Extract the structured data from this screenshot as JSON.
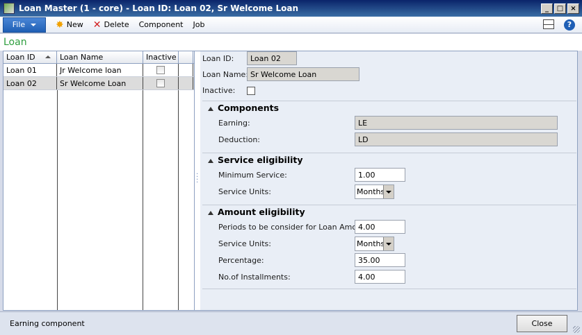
{
  "window": {
    "title": "Loan Master (1 - core) - Loan ID: Loan 02, Sr Welcome Loan"
  },
  "toolbar": {
    "file_label": "File",
    "new_label": "New",
    "delete_label": "Delete",
    "component_label": "Component",
    "job_label": "Job"
  },
  "form": {
    "title": "Loan"
  },
  "grid": {
    "columns": [
      "Loan ID",
      "Loan Name",
      "Inactive"
    ],
    "rows": [
      {
        "id": "Loan 01",
        "name": "Jr Welcome loan",
        "inactive": false
      },
      {
        "id": "Loan 02",
        "name": "Sr Welcome Loan",
        "inactive": false
      }
    ]
  },
  "details": {
    "loan_id_label": "Loan ID:",
    "loan_id_value": "Loan 02",
    "loan_name_label": "Loan Name:",
    "loan_name_value": "Sr Welcome Loan",
    "inactive_label": "Inactive:",
    "components": {
      "title": "Components",
      "earning_label": "Earning:",
      "earning_value": "LE",
      "deduction_label": "Deduction:",
      "deduction_value": "LD"
    },
    "service": {
      "title": "Service eligibility",
      "min_service_label": "Minimum Service:",
      "min_service_value": "1.00",
      "units_label": "Service Units:",
      "units_value": "Months"
    },
    "amount": {
      "title": "Amount eligibility",
      "periods_label": "Periods to be consider for Loan Amount:",
      "periods_value": "4.00",
      "units_label": "Service Units:",
      "units_value": "Months",
      "percentage_label": "Percentage:",
      "percentage_value": "35.00",
      "installments_label": "No.of Installments:",
      "installments_value": "4.00"
    }
  },
  "status": {
    "text": "Earning component",
    "close_label": "Close"
  }
}
